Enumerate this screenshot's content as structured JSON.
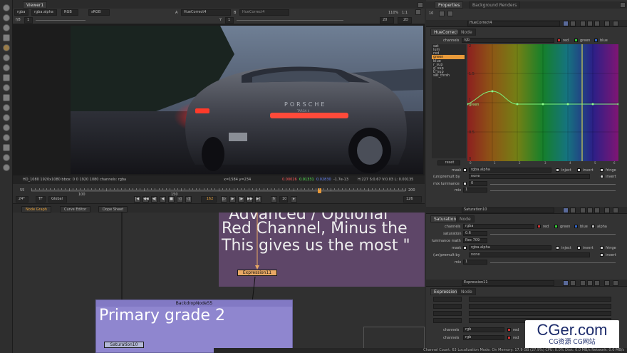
{
  "viewer": {
    "tab": "Viewer1",
    "channels": "rgba",
    "alpha_channel": "rgba.alpha",
    "colorspace_display": "RGB",
    "colorspace": "sRGB",
    "input_a_label": "A",
    "input_a": "HueCorrect4",
    "input_b_label": "B",
    "input_b": "HueCorrect4",
    "gain": "f/8",
    "gain_value": "1",
    "gamma_label": "Y",
    "gamma_value": "1",
    "zoom": "110%",
    "ratio": "1:1",
    "frame_field": "20",
    "proxy": "2D",
    "info_left": "HD_1080 1920x1080  bbox: 0 0 1920 1080 channels: rgba",
    "info_xy": "x=1584 y=234",
    "info_r": "0.00026",
    "info_g": "0.01331",
    "info_b": "0.02830",
    "info_a": "-1.7e-13",
    "info_hsvl": "H:227 S:0.67 V:0.03  L: 0.00135",
    "car_text": "PORSCHE",
    "car_model": "TARGA 4"
  },
  "timeline": {
    "start_frame": "55",
    "tick_100": "100",
    "tick_150": "150",
    "tick_200": "200",
    "current_frame": "162",
    "end_frame": "200",
    "fps": "24*",
    "tf": "TF",
    "global": "Global",
    "step": "10",
    "end_field": "126",
    "playhead_fraction": 0.77
  },
  "nodegraph": {
    "tabs": [
      "Node Graph",
      "Curve Editor",
      "Dope Sheet"
    ],
    "sticky_line1": "\"Advanced / Optional",
    "sticky_line2": "Red Channel, Minus the",
    "sticky_line3": "This gives us the most \"",
    "expression_node": "Expression11",
    "backdrop_title": "BackdropNode55",
    "backdrop_label": "Primary grade 2",
    "saturation_node": "Saturation10",
    "colors": {
      "sticky": "#5e4668",
      "backdrop": "#8f86cf",
      "node": "#e8a864",
      "saturation_node": "#b3b8d6",
      "arrow": "#e8a864"
    }
  },
  "properties": {
    "tabs": [
      "Properties",
      "Background Renders"
    ],
    "max_panels": "10",
    "huecorrect": {
      "name": "HueCorrect4",
      "tabs": [
        "HueCorrect",
        "Node"
      ],
      "channels_label": "channels",
      "channels_value": "rgb",
      "ch_red": "red",
      "ch_green": "green",
      "ch_blue": "blue",
      "curves": [
        "sat",
        "lum",
        "red",
        "green",
        "blue",
        "r_sup",
        "g_sup",
        "b_sup",
        "sat_thrsh"
      ],
      "selected_curve": "green",
      "y_ticks": [
        "2",
        "1.5",
        "1",
        "0.5",
        "0"
      ],
      "x_ticks": [
        "0",
        "1",
        "2",
        "3",
        "4",
        "5",
        "6"
      ],
      "curve_label": "green",
      "reset_label": "reset",
      "mask_label": "mask",
      "mask_value": "rgba.alpha",
      "inject": "inject",
      "invert": "invert",
      "fringe": "fringe",
      "unpremult_label": "(un)premult by",
      "unpremult_value": "none",
      "invert2": "invert",
      "mixlum_label": "mix luminance",
      "mixlum_value": "0",
      "mix_label": "mix",
      "mix_value": "1"
    },
    "saturation": {
      "name": "Saturation10",
      "tabs": [
        "Saturation",
        "Node"
      ],
      "channels_label": "channels",
      "channels_value": "rgba",
      "ch_red": "red",
      "ch_green": "green",
      "ch_blue": "blue",
      "ch_alpha": "alpha",
      "sat_label": "saturation",
      "sat_value": "0.6",
      "lum_label": "luminance math",
      "lum_value": "Rec 709",
      "mask_label": "mask",
      "mask_value": "rgba.alpha",
      "inject": "inject",
      "invert": "invert",
      "fringe": "fringe",
      "unpremult_label": "(un)premult by",
      "unpremult_value": "none",
      "invert2": "invert",
      "mix_label": "mix",
      "mix_value": "1"
    },
    "expression": {
      "name": "Expression11",
      "tabs": [
        "Expression",
        "Node"
      ],
      "channels_label": "channels",
      "ch1_value": "rgb",
      "ch2_value": "rgb",
      "ch_red": "red"
    }
  },
  "status_bar": "Channel Count: 63  Localization Mode: On  Memory: 17.9 GB (27.9%)  CPU: 0.0%  Disk: 0.0 MB/s  Network: 0.0 MB/s",
  "watermark": {
    "brand": "CGer.com",
    "sub": "CG资源 CG网站"
  }
}
